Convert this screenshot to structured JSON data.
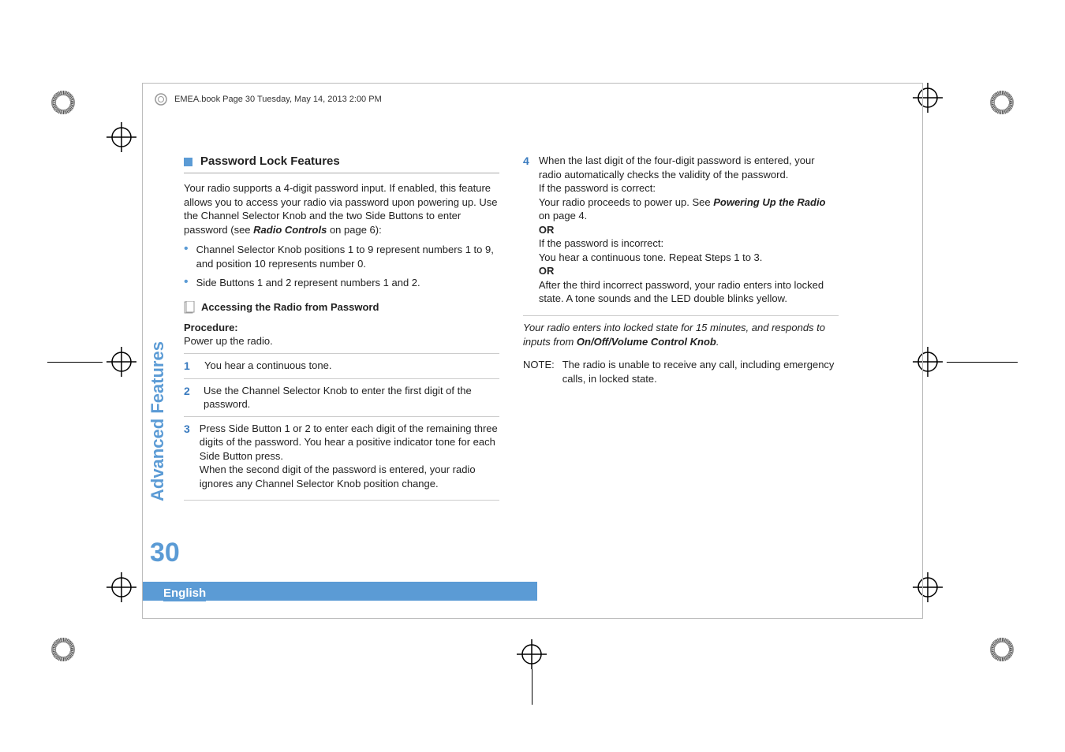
{
  "header": {
    "text": "EMEA.book  Page 30  Tuesday, May 14, 2013  2:00 PM"
  },
  "sidebar": {
    "label": "Advanced Features"
  },
  "page_number": "30",
  "language": "English",
  "left_col": {
    "section_title": "Password Lock Features",
    "intro_part1": "Your radio supports a 4-digit password input. If enabled, this feature allows you to access your radio via password upon powering up. Use the Channel Selector Knob and the two Side Buttons to enter password (see ",
    "intro_bold": "Radio Controls",
    "intro_part2": " on page 6):",
    "bullet1": "Channel Selector Knob positions 1 to 9 represent numbers 1 to 9, and position 10 represents number 0.",
    "bullet2": "Side Buttons 1 and 2 represent numbers 1 and 2.",
    "subhead": "Accessing the Radio from Password",
    "procedure_label": "Procedure:",
    "procedure_text": "Power up the radio.",
    "step1_num": "1",
    "step1": "You hear a continuous tone.",
    "step2_num": "2",
    "step2": "Use the Channel Selector Knob to enter the first digit of the password.",
    "step3_num": "3",
    "step3a": "Press Side Button 1 or 2 to enter each digit of the remaining three digits of the password. You hear a positive indicator tone for each Side Button press.",
    "step3b": "When the second digit of the password is entered, your radio ignores any Channel Selector Knob position change."
  },
  "right_col": {
    "step4_num": "4",
    "s4a": "When the last digit of the four-digit password is entered, your radio automatically checks the validity of the password.",
    "s4b": "If the password is correct:",
    "s4c_pre": "Your radio proceeds to power up. See ",
    "s4c_bold": "Powering Up the Radio",
    "s4c_post": " on page 4.",
    "or": "OR",
    "s4d": "If the password is incorrect:",
    "s4e": "You hear a continuous tone. Repeat Steps 1 to 3.",
    "s4f": "After the third incorrect password, your radio enters into locked state. A tone sounds and the LED double blinks yellow.",
    "locked_note_pre": "Your radio enters into locked state for 15 minutes, and responds to inputs from ",
    "locked_note_bold": "On/Off/Volume Control Knob",
    "locked_note_post": ".",
    "note_label": "NOTE:",
    "note_text": "The radio is unable to receive any call, including emergency calls, in locked state."
  }
}
